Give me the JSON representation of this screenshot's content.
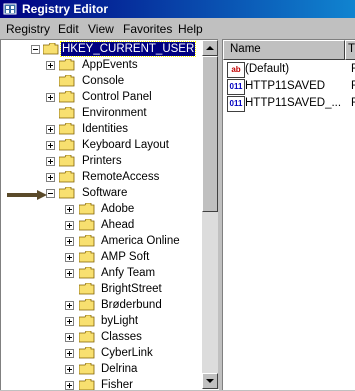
{
  "window": {
    "title": "Registry Editor"
  },
  "menu": [
    "Registry",
    "Edit",
    "View",
    "Favorites",
    "Help"
  ],
  "tree": {
    "root_expanded": "HKEY_CURRENT_USER",
    "level1": [
      "AppEvents",
      "Console",
      "Control Panel",
      "Environment",
      "Identities",
      "Keyboard Layout",
      "Printers",
      "RemoteAccess",
      "Software"
    ],
    "software_children": [
      "Adobe",
      "Ahead",
      "America Online",
      "AMP Soft",
      "Anfy Team",
      "BrightStreet",
      "Brøderbund",
      "byLight",
      "Classes",
      "CyberLink",
      "Delrina",
      "Fisher"
    ]
  },
  "values_pane": {
    "columns": [
      "Name",
      "T"
    ],
    "rows": [
      {
        "name": "(Default)",
        "type_prefix": "F",
        "icon": "string-value-icon"
      },
      {
        "name": "HTTP11SAVED",
        "type_prefix": "F",
        "icon": "binary-value-icon"
      },
      {
        "name": "HTTP11SAVED_...",
        "type_prefix": "F",
        "icon": "binary-value-icon"
      }
    ]
  },
  "colors": {
    "title_bar": "#000080",
    "selection": "#000080",
    "folder": "#f8e070",
    "annotation_arrow": "#5a4a2a"
  }
}
